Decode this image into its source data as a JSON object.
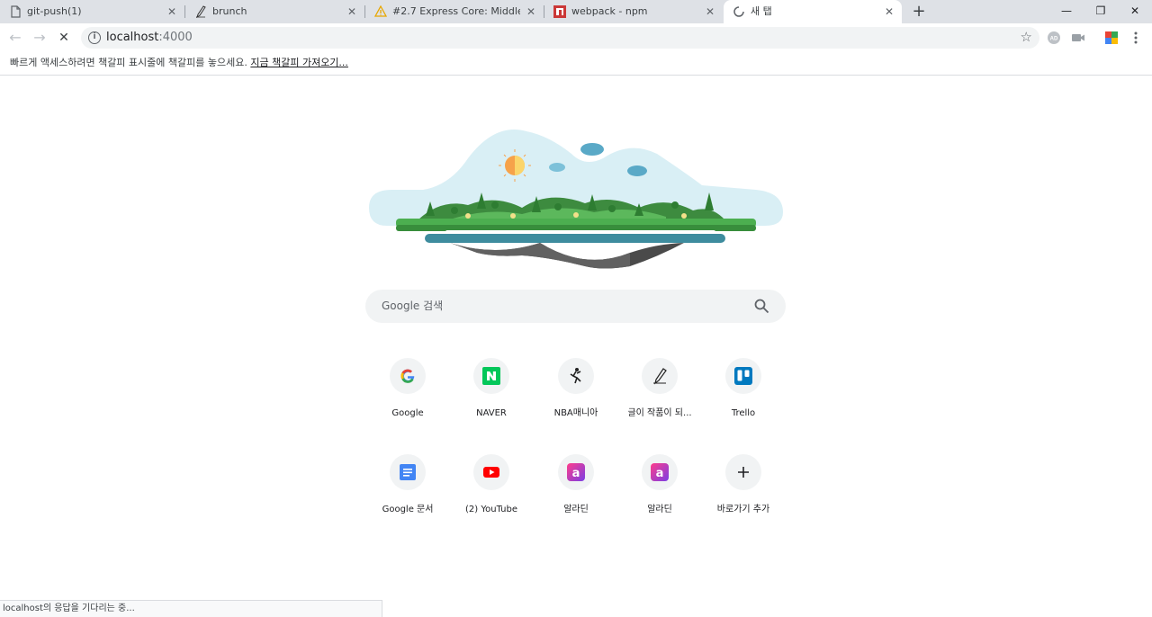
{
  "tabs": [
    {
      "title": "git-push(1)",
      "favicon": "document-icon"
    },
    {
      "title": "brunch",
      "favicon": "brunch-pen-icon"
    },
    {
      "title": "#2.7 Express Core: Middlewares",
      "favicon": "warning-icon"
    },
    {
      "title": "webpack - npm",
      "favicon": "npm-icon"
    },
    {
      "title": "새 탭",
      "favicon": "loading-spinner-icon"
    }
  ],
  "window_controls": {
    "minimize": "—",
    "restore": "❐",
    "close": "✕"
  },
  "toolbar": {
    "back": "←",
    "forward": "→",
    "stop": "✕",
    "url_host": "localhost",
    "url_port": ":4000",
    "extensions": [
      "ad-block-icon",
      "video-icon",
      "office-icon",
      "menu-icon"
    ]
  },
  "bookmark_bar": {
    "message": "빠르게 액세스하려면 책갈피 표시줄에 책갈피를 놓으세요.",
    "link": "지금 책갈피 가져오기..."
  },
  "search": {
    "placeholder": "Google 검색"
  },
  "shortcuts": [
    {
      "label": "Google",
      "icon": "google-icon"
    },
    {
      "label": "NAVER",
      "icon": "naver-icon"
    },
    {
      "label": "NBA매니아",
      "icon": "nba-mania-icon"
    },
    {
      "label": "글이 작품이 되...",
      "icon": "brunch-pen-icon"
    },
    {
      "label": "Trello",
      "icon": "trello-icon"
    },
    {
      "label": "Google 문서",
      "icon": "google-docs-icon"
    },
    {
      "label": "(2) YouTube",
      "icon": "youtube-icon"
    },
    {
      "label": "알라딘",
      "icon": "aladin-icon"
    },
    {
      "label": "알라딘",
      "icon": "aladin-icon"
    },
    {
      "label": "바로가기 추가",
      "icon": "plus-icon"
    }
  ],
  "status": {
    "text": "localhost의 응답을 기다리는 중..."
  },
  "colors": {
    "accent": "#1a73e8",
    "naver": "#03c75a",
    "youtube": "#ff0000",
    "trello": "#0079bf",
    "docs": "#4285f4"
  }
}
